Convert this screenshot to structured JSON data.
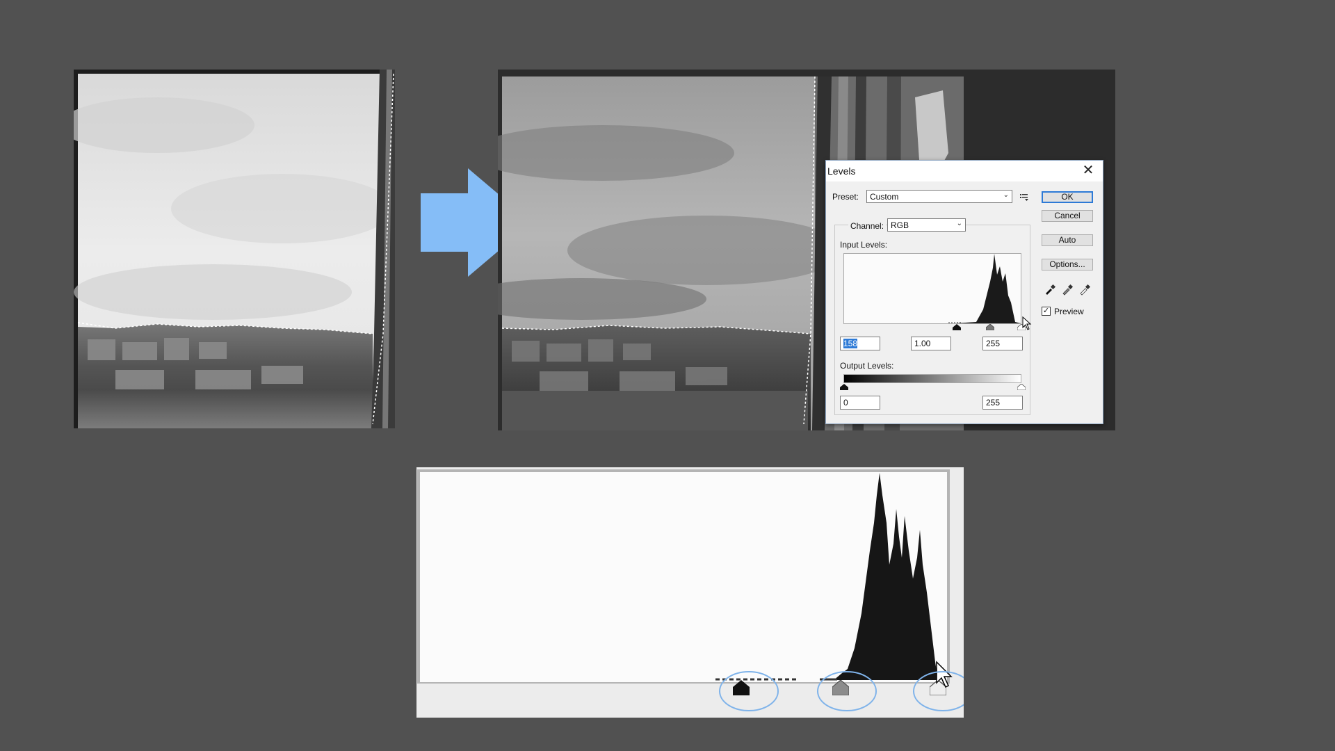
{
  "dialog": {
    "title": "Levels",
    "close_glyph": "✕",
    "preset_label": "Preset:",
    "preset_value": "Custom",
    "channel_label": "Channel:",
    "channel_value": "RGB",
    "input_levels_label": "Input Levels:",
    "input_black": "158",
    "input_gamma": "1.00",
    "input_white": "255",
    "output_levels_label": "Output Levels:",
    "output_black": "0",
    "output_white": "255",
    "buttons": {
      "ok": "OK",
      "cancel": "Cancel",
      "auto": "Auto",
      "options": "Options..."
    },
    "preview_label": "Preview",
    "preview_checked": true,
    "icons": [
      "preset-options-icon",
      "black-eyedropper-icon",
      "gray-eyedropper-icon",
      "white-eyedropper-icon",
      "close-icon",
      "chevron-down-icon",
      "cursor-icon"
    ]
  },
  "colors": {
    "background": "#515151",
    "arrow": "#85bdf7",
    "accent": "#2d7ad6",
    "highlight_circles": "#7fb3ea"
  }
}
